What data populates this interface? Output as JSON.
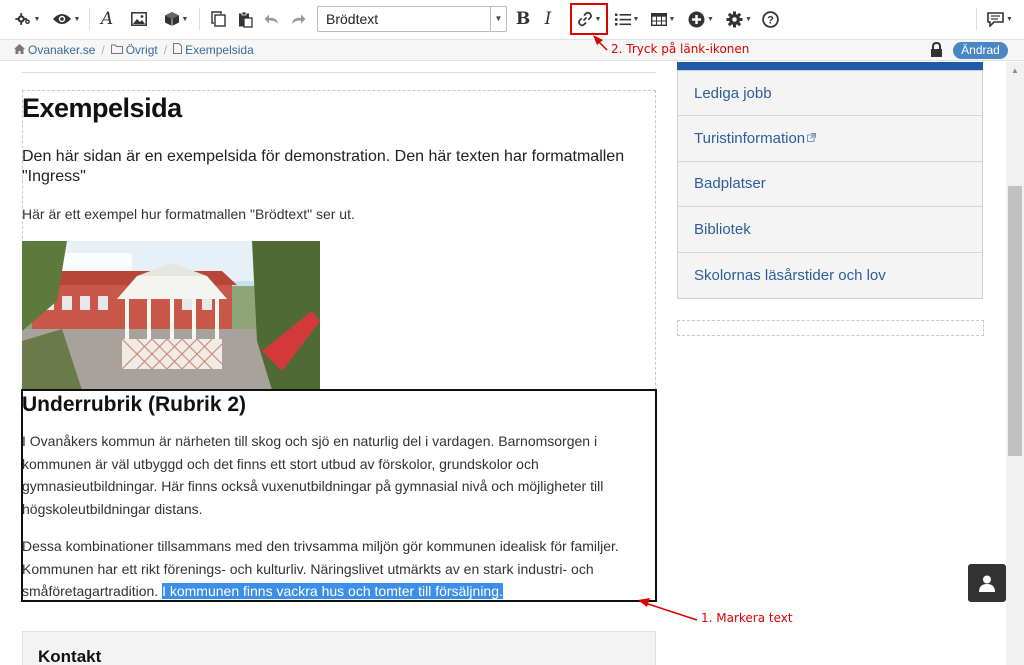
{
  "toolbar": {
    "format_value": "Brödtext",
    "icons": [
      "settings-gear-icon",
      "eye-icon",
      "text-style-icon",
      "image-icon",
      "box-icon",
      "copy-icon",
      "paste-icon",
      "undo-icon",
      "redo-icon",
      "bold-icon",
      "italic-icon",
      "link-icon",
      "list-icon",
      "table-icon",
      "plus-circle-icon",
      "gear-icon",
      "help-icon",
      "comment-icon"
    ],
    "bold_glyph": "B",
    "italic_glyph": "I",
    "text_glyph": "A",
    "help_glyph": "?"
  },
  "breadcrumb": {
    "items": [
      "Ovanaker.se",
      "Övrigt",
      "Exempelsida"
    ],
    "status_badge": "Ändrad"
  },
  "annotations": {
    "step2": "2. Tryck på länk-ikonen",
    "step1": "1. Markera text",
    "color": "#e00000"
  },
  "page": {
    "title": "Exempelsida",
    "ingress": "Den här sidan är en exempelsida för demonstration. Den här texten har formatmallen \"Ingress\"",
    "bodytext": "Här är ett exempel hur formatmallen \"Brödtext\" ser ut.",
    "heading2": "Underrubrik (Rubrik 2)",
    "paragraph1": "I Ovanåkers kommun är närheten till skog och sjö en naturlig del i vardagen. Barnomsorgen i kommunen är väl utbyggd och det finns ett stort utbud av förskolor, grundskolor och gymnasieutbildningar. Här finns också vuxenutbildningar på gymnasial nivå och möjligheter till högskoleutbildningar distans.",
    "paragraph2_plain": "Dessa kombinationer tillsammans med den trivsamma miljön gör kommunen idealisk för familjer. Kommunen har ett rikt förenings- och kulturliv. Näringslivet utmärkts av en stark industri- och småföretagartradition. ",
    "paragraph2_selected": "I kommunen finns vackra hus och tomter till försäljning.",
    "contact_title": "Kontakt"
  },
  "sidebar": {
    "items": [
      {
        "label": "Lediga jobb",
        "external": false
      },
      {
        "label": "Turistinformation",
        "external": true
      },
      {
        "label": "Badplatser",
        "external": false
      },
      {
        "label": "Bibliotek",
        "external": false
      },
      {
        "label": "Skolornas läsårstider och lov",
        "external": false
      }
    ],
    "accent_color": "#1e5ba8"
  },
  "colors": {
    "selection": "#3b8fe6",
    "badge": "#4a86c5",
    "link": "#2c5f9a"
  }
}
